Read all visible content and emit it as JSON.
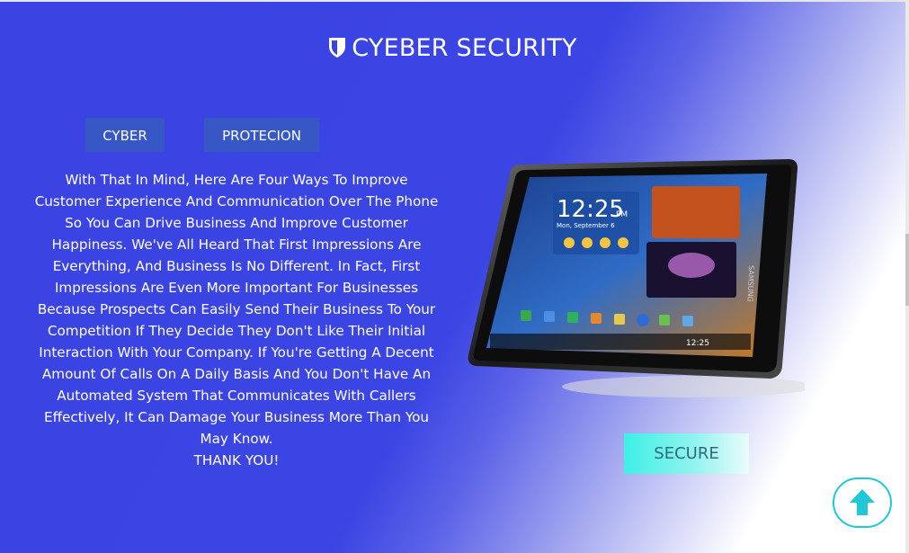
{
  "header": {
    "title": "CYEBER SECURITY",
    "icon": "shield-icon"
  },
  "tabs": [
    {
      "label": "CYBER"
    },
    {
      "label": "PROTECION"
    }
  ],
  "content": {
    "paragraph": "With That In Mind, Here Are Four Ways To Improve Customer Experience And Communication Over The Phone So You Can Drive Business And Improve Customer Happiness. We've All Heard That First Impressions Are Everything, And Business Is No Different. In Fact, First Impressions Are Even More Important For Businesses Because Prospects Can Easily Send Their Business To Your Competition If They Decide They Don't Like Their Initial Interaction With Your Company. If You're Getting A Decent Amount Of Calls On A Daily Basis And You Don't Have An Automated System That Communicates With Callers Effectively, It Can Damage Your Business More Than You May Know.",
    "thanks": "THANK YOU!"
  },
  "tablet": {
    "time": "12:25",
    "ampm": "PM",
    "date": "Mon, September 6",
    "brand": "SAMSUNG",
    "status_time": "12:25"
  },
  "secure_button": {
    "label": "SECURE"
  },
  "scroll_top": {
    "icon": "arrow-up-icon"
  },
  "colors": {
    "background": "#3b44e2",
    "tab_bg": "#3757c4",
    "accent": "#1fc8d6",
    "secure": "#3ef0e6"
  }
}
